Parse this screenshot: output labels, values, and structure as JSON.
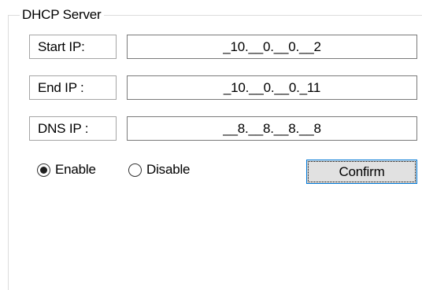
{
  "group": {
    "title": "DHCP Server"
  },
  "fields": {
    "start_ip": {
      "label": "Start IP:",
      "value": "_10.__0.__0.__2"
    },
    "end_ip": {
      "label": "End IP :",
      "value": "_10.__0.__0._11"
    },
    "dns_ip": {
      "label": "DNS IP :",
      "value": "__8.__8.__8.__8"
    }
  },
  "mode": {
    "enable_label": "Enable",
    "disable_label": "Disable",
    "selected": "Enable"
  },
  "actions": {
    "confirm_label": "Confirm"
  },
  "colors": {
    "focus_border": "#0078d7",
    "button_face": "#e1e1e1",
    "groupbox_border": "#dcdcdc"
  }
}
